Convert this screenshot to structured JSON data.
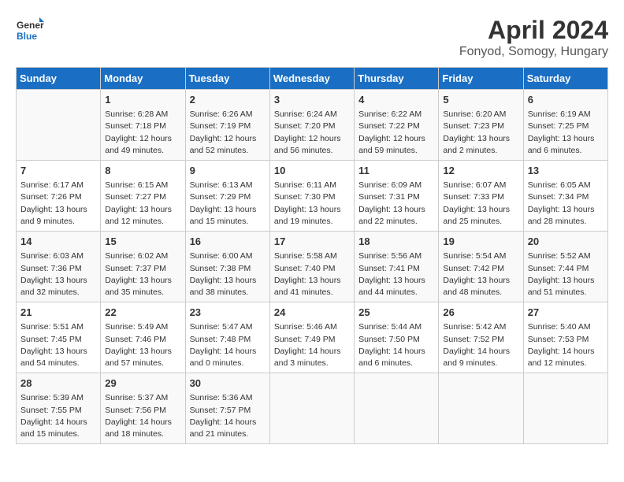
{
  "header": {
    "logo_line1": "General",
    "logo_line2": "Blue",
    "title": "April 2024",
    "subtitle": "Fonyod, Somogy, Hungary"
  },
  "calendar": {
    "days_of_week": [
      "Sunday",
      "Monday",
      "Tuesday",
      "Wednesday",
      "Thursday",
      "Friday",
      "Saturday"
    ],
    "weeks": [
      [
        {
          "day": "",
          "content": ""
        },
        {
          "day": "1",
          "content": "Sunrise: 6:28 AM\nSunset: 7:18 PM\nDaylight: 12 hours\nand 49 minutes."
        },
        {
          "day": "2",
          "content": "Sunrise: 6:26 AM\nSunset: 7:19 PM\nDaylight: 12 hours\nand 52 minutes."
        },
        {
          "day": "3",
          "content": "Sunrise: 6:24 AM\nSunset: 7:20 PM\nDaylight: 12 hours\nand 56 minutes."
        },
        {
          "day": "4",
          "content": "Sunrise: 6:22 AM\nSunset: 7:22 PM\nDaylight: 12 hours\nand 59 minutes."
        },
        {
          "day": "5",
          "content": "Sunrise: 6:20 AM\nSunset: 7:23 PM\nDaylight: 13 hours\nand 2 minutes."
        },
        {
          "day": "6",
          "content": "Sunrise: 6:19 AM\nSunset: 7:25 PM\nDaylight: 13 hours\nand 6 minutes."
        }
      ],
      [
        {
          "day": "7",
          "content": "Sunrise: 6:17 AM\nSunset: 7:26 PM\nDaylight: 13 hours\nand 9 minutes."
        },
        {
          "day": "8",
          "content": "Sunrise: 6:15 AM\nSunset: 7:27 PM\nDaylight: 13 hours\nand 12 minutes."
        },
        {
          "day": "9",
          "content": "Sunrise: 6:13 AM\nSunset: 7:29 PM\nDaylight: 13 hours\nand 15 minutes."
        },
        {
          "day": "10",
          "content": "Sunrise: 6:11 AM\nSunset: 7:30 PM\nDaylight: 13 hours\nand 19 minutes."
        },
        {
          "day": "11",
          "content": "Sunrise: 6:09 AM\nSunset: 7:31 PM\nDaylight: 13 hours\nand 22 minutes."
        },
        {
          "day": "12",
          "content": "Sunrise: 6:07 AM\nSunset: 7:33 PM\nDaylight: 13 hours\nand 25 minutes."
        },
        {
          "day": "13",
          "content": "Sunrise: 6:05 AM\nSunset: 7:34 PM\nDaylight: 13 hours\nand 28 minutes."
        }
      ],
      [
        {
          "day": "14",
          "content": "Sunrise: 6:03 AM\nSunset: 7:36 PM\nDaylight: 13 hours\nand 32 minutes."
        },
        {
          "day": "15",
          "content": "Sunrise: 6:02 AM\nSunset: 7:37 PM\nDaylight: 13 hours\nand 35 minutes."
        },
        {
          "day": "16",
          "content": "Sunrise: 6:00 AM\nSunset: 7:38 PM\nDaylight: 13 hours\nand 38 minutes."
        },
        {
          "day": "17",
          "content": "Sunrise: 5:58 AM\nSunset: 7:40 PM\nDaylight: 13 hours\nand 41 minutes."
        },
        {
          "day": "18",
          "content": "Sunrise: 5:56 AM\nSunset: 7:41 PM\nDaylight: 13 hours\nand 44 minutes."
        },
        {
          "day": "19",
          "content": "Sunrise: 5:54 AM\nSunset: 7:42 PM\nDaylight: 13 hours\nand 48 minutes."
        },
        {
          "day": "20",
          "content": "Sunrise: 5:52 AM\nSunset: 7:44 PM\nDaylight: 13 hours\nand 51 minutes."
        }
      ],
      [
        {
          "day": "21",
          "content": "Sunrise: 5:51 AM\nSunset: 7:45 PM\nDaylight: 13 hours\nand 54 minutes."
        },
        {
          "day": "22",
          "content": "Sunrise: 5:49 AM\nSunset: 7:46 PM\nDaylight: 13 hours\nand 57 minutes."
        },
        {
          "day": "23",
          "content": "Sunrise: 5:47 AM\nSunset: 7:48 PM\nDaylight: 14 hours\nand 0 minutes."
        },
        {
          "day": "24",
          "content": "Sunrise: 5:46 AM\nSunset: 7:49 PM\nDaylight: 14 hours\nand 3 minutes."
        },
        {
          "day": "25",
          "content": "Sunrise: 5:44 AM\nSunset: 7:50 PM\nDaylight: 14 hours\nand 6 minutes."
        },
        {
          "day": "26",
          "content": "Sunrise: 5:42 AM\nSunset: 7:52 PM\nDaylight: 14 hours\nand 9 minutes."
        },
        {
          "day": "27",
          "content": "Sunrise: 5:40 AM\nSunset: 7:53 PM\nDaylight: 14 hours\nand 12 minutes."
        }
      ],
      [
        {
          "day": "28",
          "content": "Sunrise: 5:39 AM\nSunset: 7:55 PM\nDaylight: 14 hours\nand 15 minutes."
        },
        {
          "day": "29",
          "content": "Sunrise: 5:37 AM\nSunset: 7:56 PM\nDaylight: 14 hours\nand 18 minutes."
        },
        {
          "day": "30",
          "content": "Sunrise: 5:36 AM\nSunset: 7:57 PM\nDaylight: 14 hours\nand 21 minutes."
        },
        {
          "day": "",
          "content": ""
        },
        {
          "day": "",
          "content": ""
        },
        {
          "day": "",
          "content": ""
        },
        {
          "day": "",
          "content": ""
        }
      ]
    ]
  }
}
